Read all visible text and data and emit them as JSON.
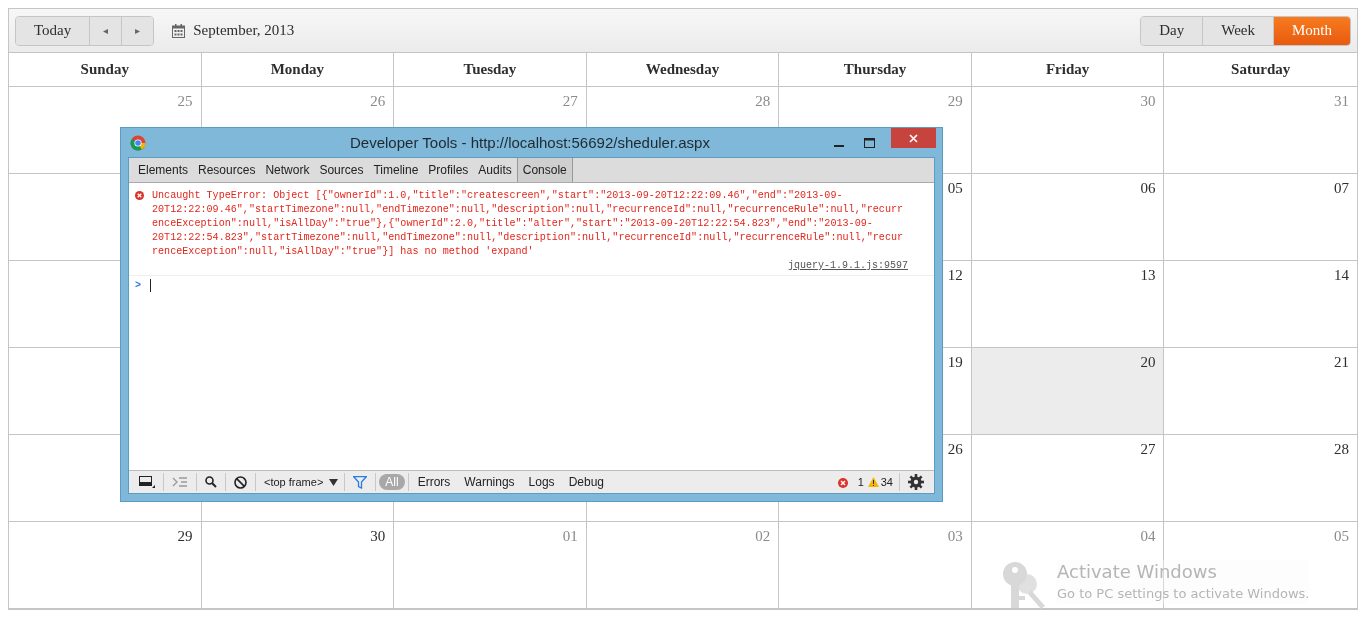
{
  "toolbar": {
    "today_button": "Today",
    "prev_button": "◂",
    "next_button": "▸",
    "date_label": "September, 2013",
    "views": [
      {
        "label": "Day",
        "selected": false
      },
      {
        "label": "Week",
        "selected": false
      },
      {
        "label": "Month",
        "selected": true
      }
    ]
  },
  "calendar": {
    "weekdays": [
      "Sunday",
      "Monday",
      "Tuesday",
      "Wednesday",
      "Thursday",
      "Friday",
      "Saturday"
    ],
    "weeks": [
      [
        {
          "day": "25",
          "other_month": true,
          "today": false
        },
        {
          "day": "26",
          "other_month": true,
          "today": false
        },
        {
          "day": "27",
          "other_month": true,
          "today": false
        },
        {
          "day": "28",
          "other_month": true,
          "today": false
        },
        {
          "day": "29",
          "other_month": true,
          "today": false
        },
        {
          "day": "30",
          "other_month": true,
          "today": false
        },
        {
          "day": "31",
          "other_month": true,
          "today": false
        }
      ],
      [
        {
          "day": "05",
          "other_month": false,
          "today": false
        },
        {
          "day": "06",
          "other_month": false,
          "today": false
        },
        {
          "day": "07",
          "other_month": false,
          "today": false
        }
      ],
      [
        {
          "day": "12",
          "other_month": false,
          "today": false
        },
        {
          "day": "13",
          "other_month": false,
          "today": false
        },
        {
          "day": "14",
          "other_month": false,
          "today": false
        }
      ],
      [
        {
          "day": "19",
          "other_month": false,
          "today": false
        },
        {
          "day": "20",
          "other_month": false,
          "today": true
        },
        {
          "day": "21",
          "other_month": false,
          "today": false
        }
      ],
      [
        {
          "day": "26",
          "other_month": false,
          "today": false
        },
        {
          "day": "27",
          "other_month": false,
          "today": false
        },
        {
          "day": "28",
          "other_month": false,
          "today": false
        }
      ],
      [
        {
          "day": "29",
          "other_month": false,
          "today": false
        },
        {
          "day": "30",
          "other_month": false,
          "today": false
        },
        {
          "day": "01",
          "other_month": true,
          "today": false
        },
        {
          "day": "02",
          "other_month": true,
          "today": false
        },
        {
          "day": "03",
          "other_month": true,
          "today": false
        },
        {
          "day": "04",
          "other_month": true,
          "today": false
        },
        {
          "day": "05",
          "other_month": true,
          "today": false
        }
      ]
    ]
  },
  "devtools": {
    "title": "Developer Tools - http://localhost:56692/sheduler.aspx",
    "tabs": [
      {
        "label": "Elements",
        "selected": false
      },
      {
        "label": "Resources",
        "selected": false
      },
      {
        "label": "Network",
        "selected": false
      },
      {
        "label": "Sources",
        "selected": false
      },
      {
        "label": "Timeline",
        "selected": false
      },
      {
        "label": "Profiles",
        "selected": false
      },
      {
        "label": "Audits",
        "selected": false
      },
      {
        "label": "Console",
        "selected": true
      }
    ],
    "console": {
      "message": "Uncaught TypeError: Object [{\"ownerId\":1.0,\"title\":\"createscreen\",\"start\":\"2013-09-20T12:22:09.46\",\"end\":\"2013-09-20T12:22:09.46\",\"startTimezone\":null,\"endTimezone\":null,\"description\":null,\"recurrenceId\":null,\"recurrenceRule\":null,\"recurrenceException\":null,\"isAllDay\":\"true\"},{\"ownerId\":2.0,\"title\":\"alter\",\"start\":\"2013-09-20T12:22:54.823\",\"end\":\"2013-09-20T12:22:54.823\",\"startTimezone\":null,\"endTimezone\":null,\"description\":null,\"recurrenceId\":null,\"recurrenceRule\":null,\"recurrenceException\":null,\"isAllDay\":\"true\"}] has no method 'expand'",
      "source": "jquery-1.9.1.js:9597",
      "prompt": ">"
    },
    "bottom_bar": {
      "frame_select": "<top frame>",
      "filters": [
        {
          "label": "All",
          "selected": true
        },
        {
          "label": "Errors",
          "selected": false
        },
        {
          "label": "Warnings",
          "selected": false
        },
        {
          "label": "Logs",
          "selected": false
        },
        {
          "label": "Debug",
          "selected": false
        }
      ],
      "error_count": "1",
      "warning_count": "34"
    }
  },
  "activation": {
    "title": "Activate Windows",
    "subtitle": "Go to PC settings to activate Windows."
  }
}
